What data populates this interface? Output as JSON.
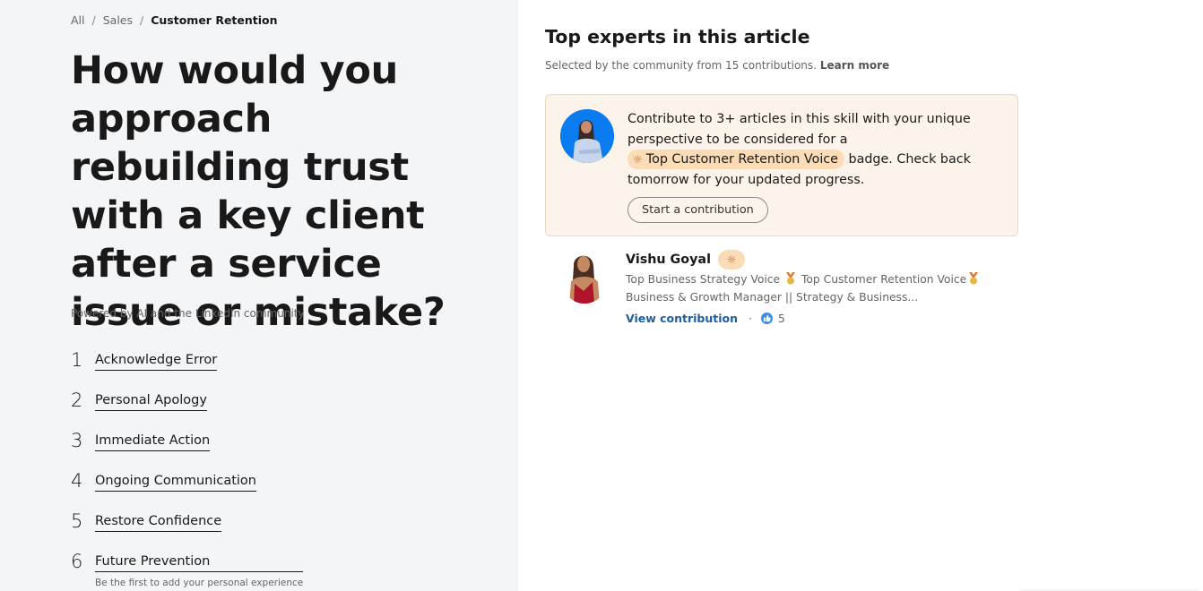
{
  "breadcrumb": {
    "items": [
      "All",
      "Sales"
    ],
    "current": "Customer Retention",
    "separator": "/"
  },
  "article": {
    "title": "How would you approach rebuilding trust with a key client after a service issue or mistake?",
    "powered_by": "Powered by AI and the LinkedIn community",
    "steps": [
      {
        "num": "1",
        "label": "Acknowledge Error"
      },
      {
        "num": "2",
        "label": "Personal Apology"
      },
      {
        "num": "3",
        "label": "Immediate Action"
      },
      {
        "num": "4",
        "label": "Ongoing Communication"
      },
      {
        "num": "5",
        "label": "Restore Confidence"
      },
      {
        "num": "6",
        "label": "Future Prevention",
        "sub": "Be the first to add your personal experience"
      }
    ]
  },
  "experts": {
    "title": "Top experts in this article",
    "subtitle": "Selected by the community from 15 contributions.",
    "learn_more": "Learn more",
    "promo": {
      "text_before": "Contribute to 3+ articles in this skill with your unique perspective to be considered for a",
      "badge_label": "Top Customer Retention Voice",
      "badge_icon": "lightbulb-icon",
      "text_after": "badge. Check back tomorrow for your updated progress.",
      "button_label": "Start a contribution"
    },
    "list": [
      {
        "name": "Vishu Goyal",
        "badge_icon": "lightbulb-icon",
        "headline_1a": "Top Business Strategy Voice",
        "headline_1b": "Top Customer Retention Voice",
        "headline_2": "Business & Growth Manager || Strategy & Business...",
        "view_label": "View contribution",
        "separator": "·",
        "likes": "5"
      }
    ]
  },
  "colors": {
    "left_bg": "#f4f5f7",
    "promo_bg": "#fcf4ea",
    "badge_bg": "#fbdcb6",
    "link_blue": "#1d5fa0",
    "like_blue": "#378fe9"
  }
}
